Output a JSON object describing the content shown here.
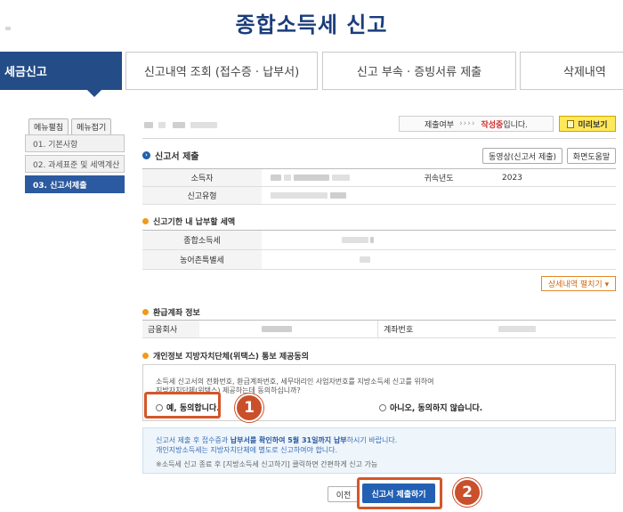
{
  "page": {
    "title": "종합소득세 신고"
  },
  "tabs": [
    {
      "label": "세금신고",
      "active": true
    },
    {
      "label": "신고내역 조회 (접수증 · 납부서)"
    },
    {
      "label": "신고 부속 · 증빙서류 제출"
    },
    {
      "label": "삭제내역"
    }
  ],
  "menu": {
    "expand_label": "메뉴펼침",
    "collapse_label": "메뉴접기"
  },
  "sidenav": {
    "items": [
      {
        "label": "01. 기본사항"
      },
      {
        "label": "02. 과세표준 및 세액계산"
      },
      {
        "label": "03. 신고서제출",
        "active": true
      }
    ]
  },
  "status": {
    "label": "제출여부",
    "separator": "››››",
    "value": "작성중",
    "suffix": "입니다.",
    "preview_label": "미리보기"
  },
  "submit_section": {
    "title": "신고서 제출",
    "video_btn": "동영상(신고서 제출)",
    "help_btn": "화면도움말",
    "rows": {
      "taxpayer_label": "소득자",
      "year_label": "귀속년도",
      "year_value": "2023",
      "type_label": "신고유형"
    }
  },
  "tax_section": {
    "title": "신고기한 내 납부할 세액",
    "income_tax_label": "종합소득세",
    "rural_tax_label": "농어촌특별세",
    "detail_btn": "상세내역 펼치기 ▾"
  },
  "refund_section": {
    "title": "환급계좌 정보",
    "bank_label": "금융회사",
    "account_label": "계좌번호"
  },
  "consent_section": {
    "title": "개인정보 지방자치단체(위택스) 통보 제공동의",
    "question_line1": "소득세 신고서의 전화번호, 환급계좌번호, 세무대리인 사업자번호를 지방소득세 신고를 위하여",
    "question_line2": "지방자치단체(위택스) 제공하는데 동의하십니까?",
    "yes_label": "예, 동의합니다.",
    "no_label": "아니오, 동의하지 않습니다."
  },
  "notice": {
    "line1_pre": "신고서 제출 후 접수증과 ",
    "line1_bold": "납부서를 확인하여 5월 31일까지 납부",
    "line1_post": "하시기 바랍니다.",
    "line2": "개인지방소득세는 지방자치단체에 별도로 신고하여야 합니다.",
    "line3": "※소득세 신고 종료 후 [지방소득세 신고하기] 클릭하면 간편하게 신고 가능"
  },
  "actions": {
    "prev_label": "이전",
    "submit_label": "신고서 제출하기"
  },
  "annotations": {
    "step1": "1",
    "step2": "2"
  },
  "colors": {
    "primary": "#244c87",
    "highlight": "#d4572a",
    "accent_orange": "#f09a1a",
    "status_red": "#d03030",
    "preview_yellow": "#ffe85a"
  }
}
